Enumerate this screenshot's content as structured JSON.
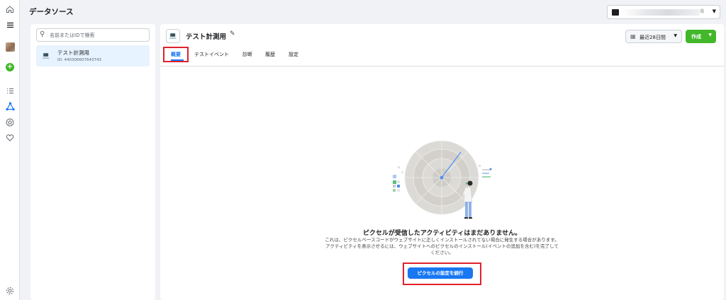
{
  "page_title": "データソース",
  "search": {
    "placeholder": "名前またはIDで検索"
  },
  "pixel_item": {
    "name": "テスト計測用",
    "id_text": "ID: 440306607643743"
  },
  "header": {
    "title": "テスト計測用"
  },
  "date_range": {
    "label": "最近28日間"
  },
  "create_button": {
    "label": "作成"
  },
  "tabs": [
    {
      "label": "概要",
      "active": true
    },
    {
      "label": "テストイベント"
    },
    {
      "label": "診断"
    },
    {
      "label": "履歴"
    },
    {
      "label": "設定"
    }
  ],
  "empty_state": {
    "title": "ピクセルが受信したアクティビティはまだありません。",
    "desc_line1": "これは、ピクセルベースコードがウェブサイトに正しくインストールされてない場合に発生する場合があります。",
    "desc_line2": "アクティビティを表示させるには、ウェブサイトへのピクセルのインストール(イベントの追加を含む)を完了して",
    "desc_line3": "ください。",
    "cta": "ピクセルの設定を続行"
  },
  "account_selector": {
    "suffix": "l)"
  },
  "icons": [
    "home-icon",
    "menu-icon",
    "plus-icon",
    "list-icon",
    "data-sources-icon",
    "star-icon",
    "heart-icon",
    "settings-icon",
    "search-icon",
    "laptop-icon",
    "pencil-icon",
    "calendar-icon",
    "chevron-down-icon",
    "radar-illustration"
  ],
  "colors": {
    "accent": "#1877f2",
    "create": "#42b72a",
    "highlight": "#e0212b"
  }
}
